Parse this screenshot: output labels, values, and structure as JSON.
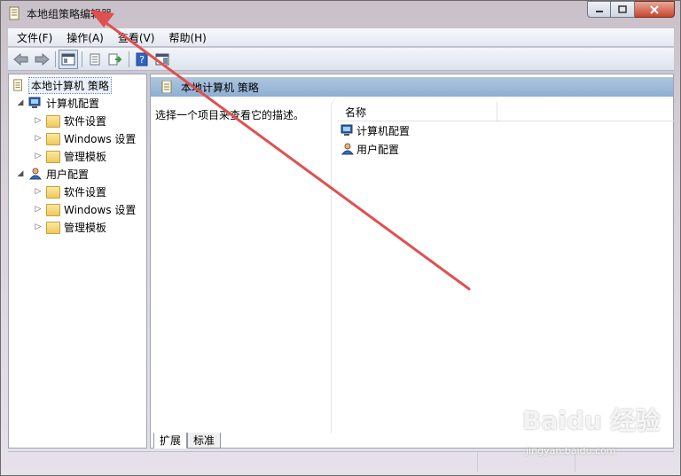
{
  "window": {
    "title": "本地组策略编辑器",
    "controls": {
      "minimize": "–",
      "maximize": "□",
      "close": "✕"
    }
  },
  "menubar": {
    "items": [
      "文件(F)",
      "操作(A)",
      "查看(V)",
      "帮助(H)"
    ]
  },
  "toolbar": {
    "buttons": [
      "back-icon",
      "forward-icon",
      "show-hide-tree-icon",
      "properties-icon",
      "export-list-icon",
      "help-icon",
      "show-hide-action-pane-icon"
    ]
  },
  "tree": {
    "root": "本地计算机 策略",
    "nodes": [
      {
        "label": "计算机配置",
        "children": [
          "软件设置",
          "Windows 设置",
          "管理模板"
        ]
      },
      {
        "label": "用户配置",
        "children": [
          "软件设置",
          "Windows 设置",
          "管理模板"
        ]
      }
    ]
  },
  "content": {
    "header": "本地计算机 策略",
    "description": "选择一个项目来查看它的描述。",
    "column_header": "名称",
    "items": [
      "计算机配置",
      "用户配置"
    ],
    "tabs": [
      "扩展",
      "标准"
    ]
  },
  "watermark": {
    "main": "Baidu 经验",
    "sub": "jingyan.baidu.com"
  },
  "colors": {
    "annotation_arrow": "#e05050",
    "header_blue": "#9ab7d8",
    "folder_yellow": "#f0c95a"
  }
}
